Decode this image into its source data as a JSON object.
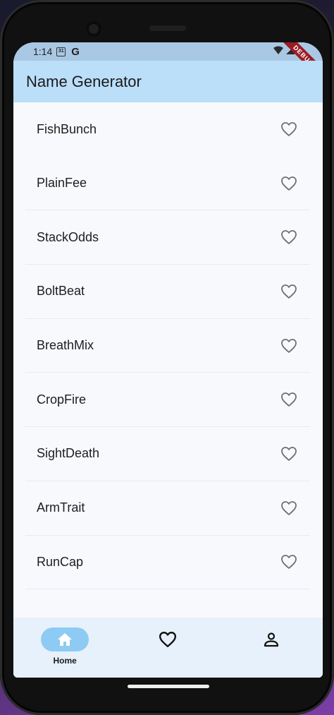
{
  "status_bar": {
    "time": "1:14",
    "calendar_day": "31",
    "google_letter": "G",
    "debug_banner": "DEBUG"
  },
  "app_bar": {
    "title": "Name Generator"
  },
  "names": [
    {
      "label": "FishBunch",
      "icon": "heart-outline-icon"
    },
    {
      "label": "PlainFee",
      "icon": "heart-outline-icon"
    },
    {
      "label": "StackOdds",
      "icon": "heart-outline-icon"
    },
    {
      "label": "BoltBeat",
      "icon": "heart-outline-icon"
    },
    {
      "label": "BreathMix",
      "icon": "heart-outline-icon"
    },
    {
      "label": "CropFire",
      "icon": "heart-outline-icon"
    },
    {
      "label": "SightDeath",
      "icon": "heart-outline-icon"
    },
    {
      "label": "ArmTrait",
      "icon": "heart-outline-icon"
    },
    {
      "label": "RunCap",
      "icon": "heart-outline-icon"
    }
  ],
  "bottom_nav": {
    "home_label": "Home",
    "selected": "home"
  },
  "colors": {
    "app_bar": "#bbdef9",
    "status_bar": "#a9c8e4",
    "nav_bar": "#e7f1fc",
    "nav_pill": "#8ecbf4",
    "debug_ribbon": "#9b1c25"
  }
}
